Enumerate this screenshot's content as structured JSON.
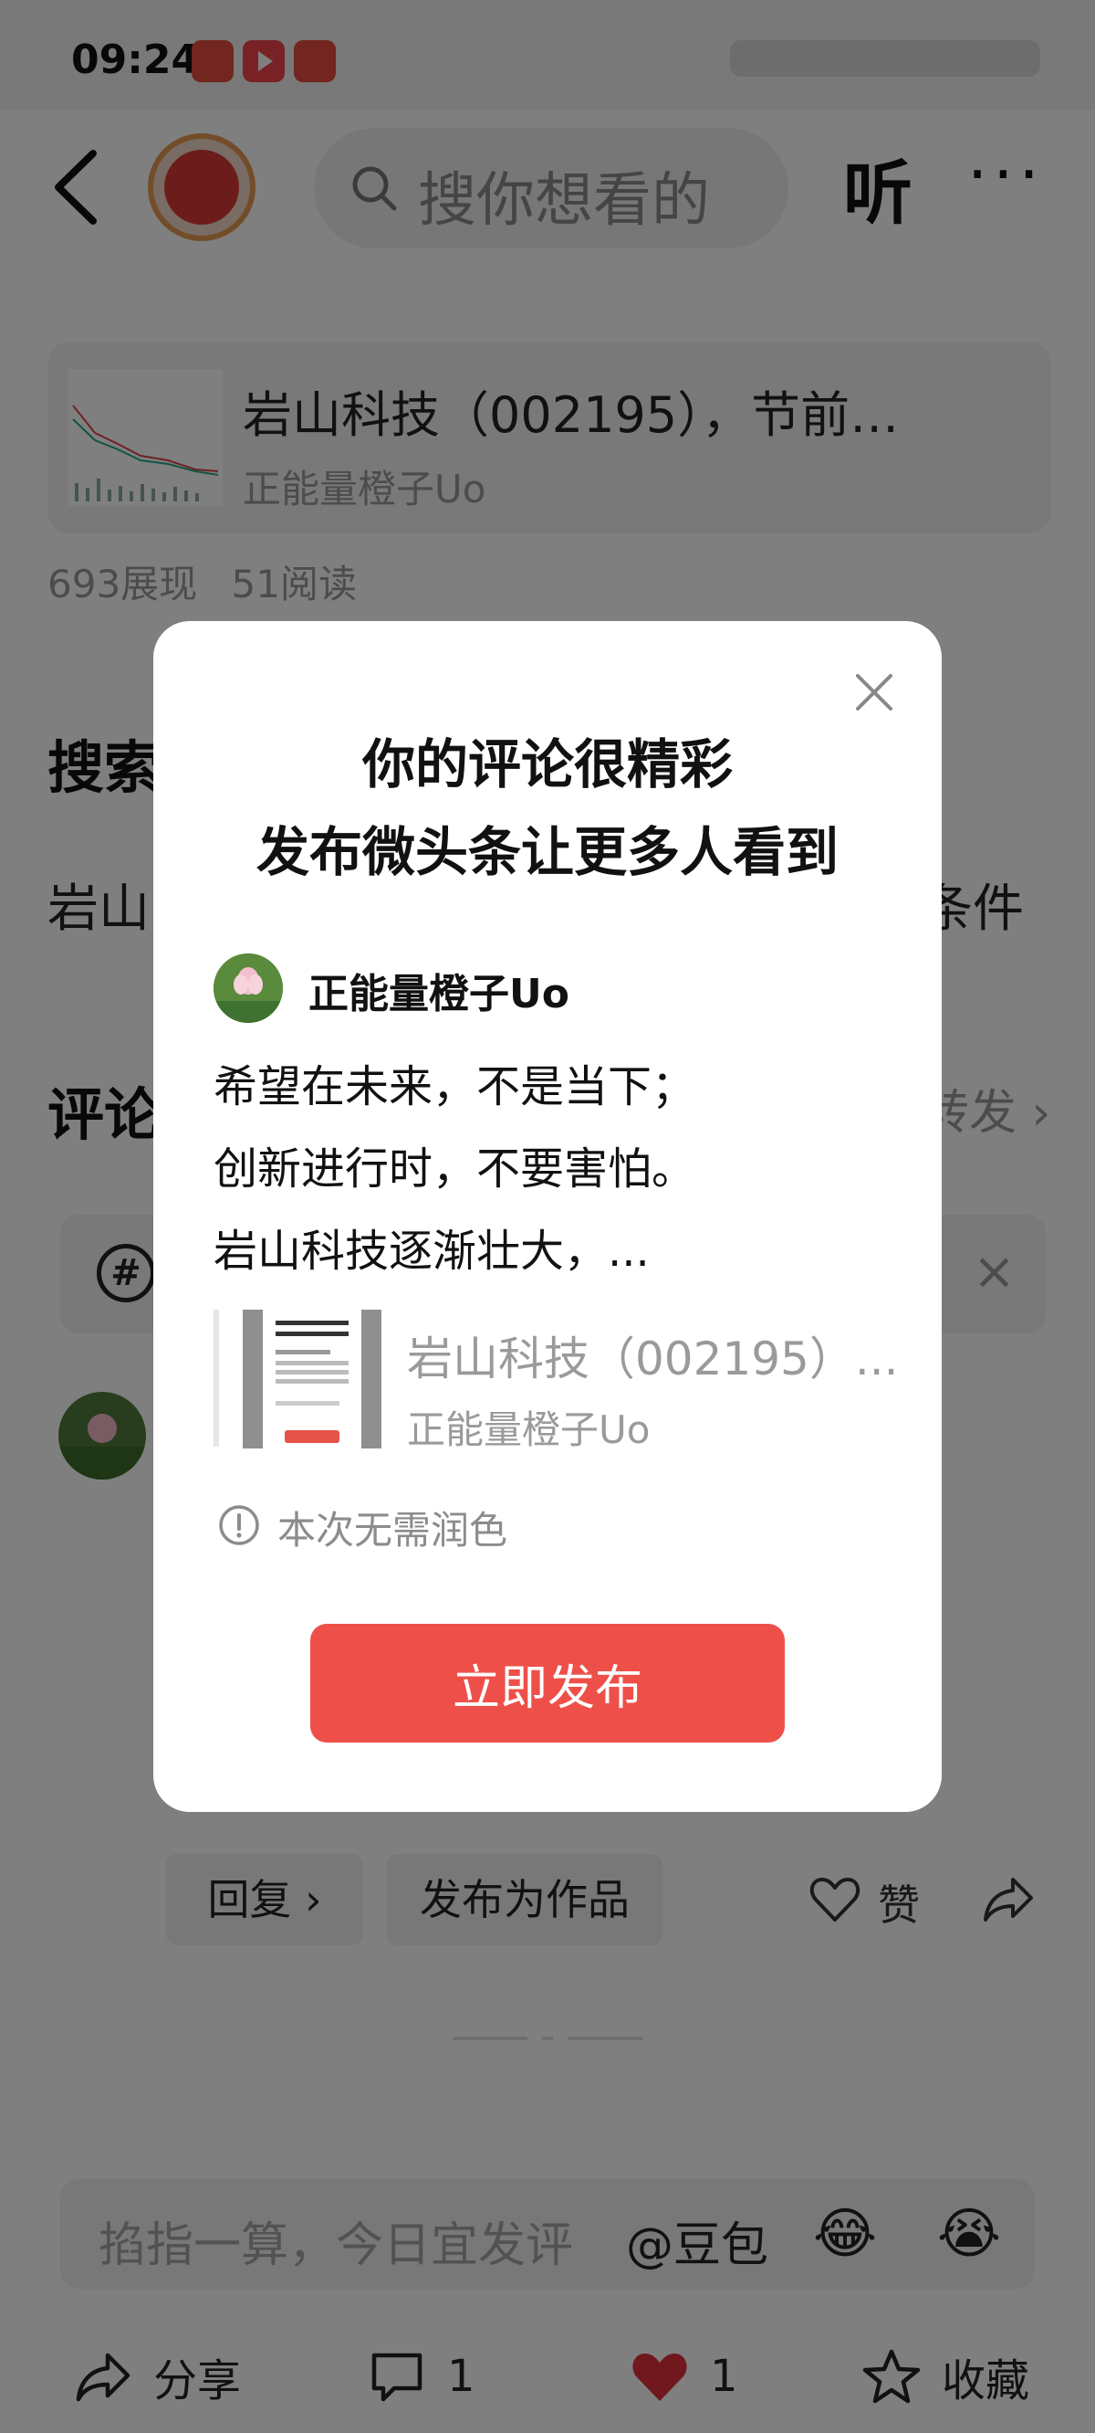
{
  "status_bar": {
    "time": "09:24"
  },
  "header": {
    "search_placeholder": "搜你想看的",
    "listen_label": "听",
    "more_label": "···"
  },
  "article": {
    "title": "岩山科技（002195），节前…",
    "author": "正能量橙子Uo"
  },
  "stats": {
    "impressions": "693展现",
    "reads": "51阅读"
  },
  "search_section": {
    "heading": "搜索",
    "line_start": "岩山",
    "line_end": "条件"
  },
  "comments_section": {
    "heading": "评论",
    "repost_link": "转发 ›"
  },
  "topic_bar": {
    "hash": "#",
    "close": "×"
  },
  "comment_actions": {
    "reply": "回复 ›",
    "publish_as_work": "发布为作品",
    "like": "赞"
  },
  "input_bar": {
    "placeholder": "掐指一算，今日宜发评",
    "mention": "@豆包",
    "emojis": [
      "😂",
      "😭"
    ]
  },
  "bottom_bar": {
    "share": "分享",
    "comment_count": "1",
    "like_count": "1",
    "favorite": "收藏"
  },
  "dialog": {
    "title_line1": "你的评论很精彩",
    "title_line2": "发布微头条让更多人看到",
    "author": "正能量橙子Uo",
    "content_lines": [
      "希望在未来，不是当下；",
      "创新进行时，不要害怕。",
      "岩山科技逐渐壮大，..."
    ],
    "quote_title": "岩山科技（002195）...",
    "quote_author": "正能量橙子Uo",
    "notice": "本次无需润色",
    "publish_button": "立即发布"
  },
  "colors": {
    "accent": "#ee5049",
    "like_red": "#e0313a",
    "overlay": "rgba(0,0,0,0.5)"
  }
}
